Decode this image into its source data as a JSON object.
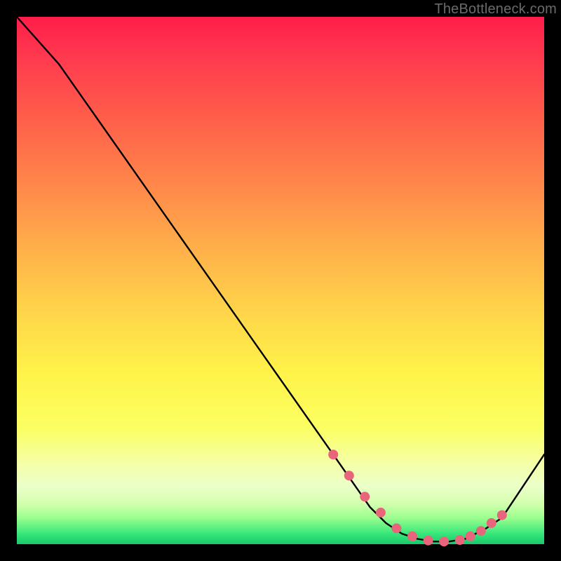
{
  "watermark": "TheBottleneck.com",
  "colors": {
    "page_bg": "#000000",
    "marker": "#e9657c",
    "line": "#000000"
  },
  "chart_data": {
    "type": "line",
    "title": "",
    "xlabel": "",
    "ylabel": "",
    "xlim": [
      0,
      100
    ],
    "ylim": [
      0,
      100
    ],
    "grid": false,
    "legend": false,
    "series": [
      {
        "name": "curve",
        "x": [
          0,
          8,
          60,
          67,
          70,
          73,
          76,
          79,
          82,
          85,
          87,
          89,
          92,
          100
        ],
        "y": [
          100,
          91,
          17,
          7,
          4,
          2,
          1,
          0.5,
          0.5,
          1,
          2,
          3,
          5,
          17
        ]
      }
    ],
    "markers": {
      "name": "highlight",
      "x": [
        60,
        63,
        66,
        69,
        72,
        75,
        78,
        81,
        84,
        86,
        88,
        90,
        92
      ],
      "y": [
        17,
        13,
        9,
        6,
        3,
        1.5,
        0.7,
        0.5,
        0.8,
        1.5,
        2.5,
        4,
        5.5
      ]
    }
  }
}
